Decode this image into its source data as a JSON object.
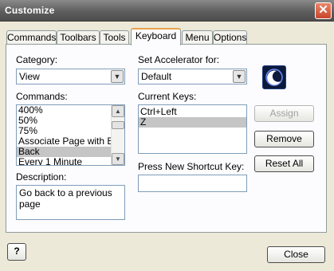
{
  "window": {
    "title": "Customize",
    "close_glyph": "✕"
  },
  "tabs": [
    {
      "label": "Commands"
    },
    {
      "label": "Toolbars"
    },
    {
      "label": "Tools"
    },
    {
      "label": "Keyboard",
      "active": true
    },
    {
      "label": "Menu"
    },
    {
      "label": "Options"
    }
  ],
  "category": {
    "label": "Category:",
    "value": "View"
  },
  "commands": {
    "label": "Commands:",
    "items": [
      "400%",
      "50%",
      "75%",
      "Associate Page with Eng",
      "Back",
      "Every 1 Minute"
    ],
    "selected": "Back"
  },
  "description": {
    "label": "Description:",
    "text": "Go back to a previous page"
  },
  "accelerator": {
    "label": "Set Accelerator for:",
    "value": "Default"
  },
  "current_keys": {
    "label": "Current Keys:",
    "items": [
      "Ctrl+Left",
      "Z"
    ],
    "selected": "Z"
  },
  "shortcut": {
    "label": "Press New Shortcut Key:",
    "value": ""
  },
  "buttons": {
    "assign": "Assign",
    "remove": "Remove",
    "reset_all": "Reset All",
    "close": "Close",
    "help": "?"
  },
  "icons": {
    "moon": "moon-icon",
    "scroll_up": "▲",
    "scroll_down": "▼",
    "dropdown": "▼"
  }
}
